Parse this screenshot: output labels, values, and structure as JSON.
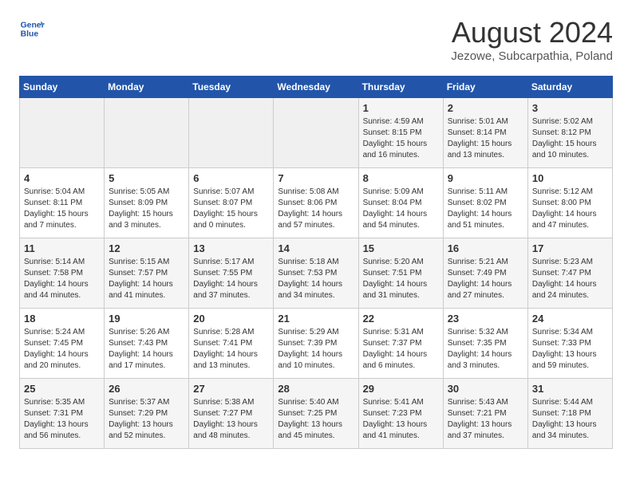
{
  "header": {
    "logo_line1": "General",
    "logo_line2": "Blue",
    "month_year": "August 2024",
    "location": "Jezowe, Subcarpathia, Poland"
  },
  "weekdays": [
    "Sunday",
    "Monday",
    "Tuesday",
    "Wednesday",
    "Thursday",
    "Friday",
    "Saturday"
  ],
  "weeks": [
    [
      {
        "day": "",
        "info": ""
      },
      {
        "day": "",
        "info": ""
      },
      {
        "day": "",
        "info": ""
      },
      {
        "day": "",
        "info": ""
      },
      {
        "day": "1",
        "info": "Sunrise: 4:59 AM\nSunset: 8:15 PM\nDaylight: 15 hours\nand 16 minutes."
      },
      {
        "day": "2",
        "info": "Sunrise: 5:01 AM\nSunset: 8:14 PM\nDaylight: 15 hours\nand 13 minutes."
      },
      {
        "day": "3",
        "info": "Sunrise: 5:02 AM\nSunset: 8:12 PM\nDaylight: 15 hours\nand 10 minutes."
      }
    ],
    [
      {
        "day": "4",
        "info": "Sunrise: 5:04 AM\nSunset: 8:11 PM\nDaylight: 15 hours\nand 7 minutes."
      },
      {
        "day": "5",
        "info": "Sunrise: 5:05 AM\nSunset: 8:09 PM\nDaylight: 15 hours\nand 3 minutes."
      },
      {
        "day": "6",
        "info": "Sunrise: 5:07 AM\nSunset: 8:07 PM\nDaylight: 15 hours\nand 0 minutes."
      },
      {
        "day": "7",
        "info": "Sunrise: 5:08 AM\nSunset: 8:06 PM\nDaylight: 14 hours\nand 57 minutes."
      },
      {
        "day": "8",
        "info": "Sunrise: 5:09 AM\nSunset: 8:04 PM\nDaylight: 14 hours\nand 54 minutes."
      },
      {
        "day": "9",
        "info": "Sunrise: 5:11 AM\nSunset: 8:02 PM\nDaylight: 14 hours\nand 51 minutes."
      },
      {
        "day": "10",
        "info": "Sunrise: 5:12 AM\nSunset: 8:00 PM\nDaylight: 14 hours\nand 47 minutes."
      }
    ],
    [
      {
        "day": "11",
        "info": "Sunrise: 5:14 AM\nSunset: 7:58 PM\nDaylight: 14 hours\nand 44 minutes."
      },
      {
        "day": "12",
        "info": "Sunrise: 5:15 AM\nSunset: 7:57 PM\nDaylight: 14 hours\nand 41 minutes."
      },
      {
        "day": "13",
        "info": "Sunrise: 5:17 AM\nSunset: 7:55 PM\nDaylight: 14 hours\nand 37 minutes."
      },
      {
        "day": "14",
        "info": "Sunrise: 5:18 AM\nSunset: 7:53 PM\nDaylight: 14 hours\nand 34 minutes."
      },
      {
        "day": "15",
        "info": "Sunrise: 5:20 AM\nSunset: 7:51 PM\nDaylight: 14 hours\nand 31 minutes."
      },
      {
        "day": "16",
        "info": "Sunrise: 5:21 AM\nSunset: 7:49 PM\nDaylight: 14 hours\nand 27 minutes."
      },
      {
        "day": "17",
        "info": "Sunrise: 5:23 AM\nSunset: 7:47 PM\nDaylight: 14 hours\nand 24 minutes."
      }
    ],
    [
      {
        "day": "18",
        "info": "Sunrise: 5:24 AM\nSunset: 7:45 PM\nDaylight: 14 hours\nand 20 minutes."
      },
      {
        "day": "19",
        "info": "Sunrise: 5:26 AM\nSunset: 7:43 PM\nDaylight: 14 hours\nand 17 minutes."
      },
      {
        "day": "20",
        "info": "Sunrise: 5:28 AM\nSunset: 7:41 PM\nDaylight: 14 hours\nand 13 minutes."
      },
      {
        "day": "21",
        "info": "Sunrise: 5:29 AM\nSunset: 7:39 PM\nDaylight: 14 hours\nand 10 minutes."
      },
      {
        "day": "22",
        "info": "Sunrise: 5:31 AM\nSunset: 7:37 PM\nDaylight: 14 hours\nand 6 minutes."
      },
      {
        "day": "23",
        "info": "Sunrise: 5:32 AM\nSunset: 7:35 PM\nDaylight: 14 hours\nand 3 minutes."
      },
      {
        "day": "24",
        "info": "Sunrise: 5:34 AM\nSunset: 7:33 PM\nDaylight: 13 hours\nand 59 minutes."
      }
    ],
    [
      {
        "day": "25",
        "info": "Sunrise: 5:35 AM\nSunset: 7:31 PM\nDaylight: 13 hours\nand 56 minutes."
      },
      {
        "day": "26",
        "info": "Sunrise: 5:37 AM\nSunset: 7:29 PM\nDaylight: 13 hours\nand 52 minutes."
      },
      {
        "day": "27",
        "info": "Sunrise: 5:38 AM\nSunset: 7:27 PM\nDaylight: 13 hours\nand 48 minutes."
      },
      {
        "day": "28",
        "info": "Sunrise: 5:40 AM\nSunset: 7:25 PM\nDaylight: 13 hours\nand 45 minutes."
      },
      {
        "day": "29",
        "info": "Sunrise: 5:41 AM\nSunset: 7:23 PM\nDaylight: 13 hours\nand 41 minutes."
      },
      {
        "day": "30",
        "info": "Sunrise: 5:43 AM\nSunset: 7:21 PM\nDaylight: 13 hours\nand 37 minutes."
      },
      {
        "day": "31",
        "info": "Sunrise: 5:44 AM\nSunset: 7:18 PM\nDaylight: 13 hours\nand 34 minutes."
      }
    ]
  ]
}
